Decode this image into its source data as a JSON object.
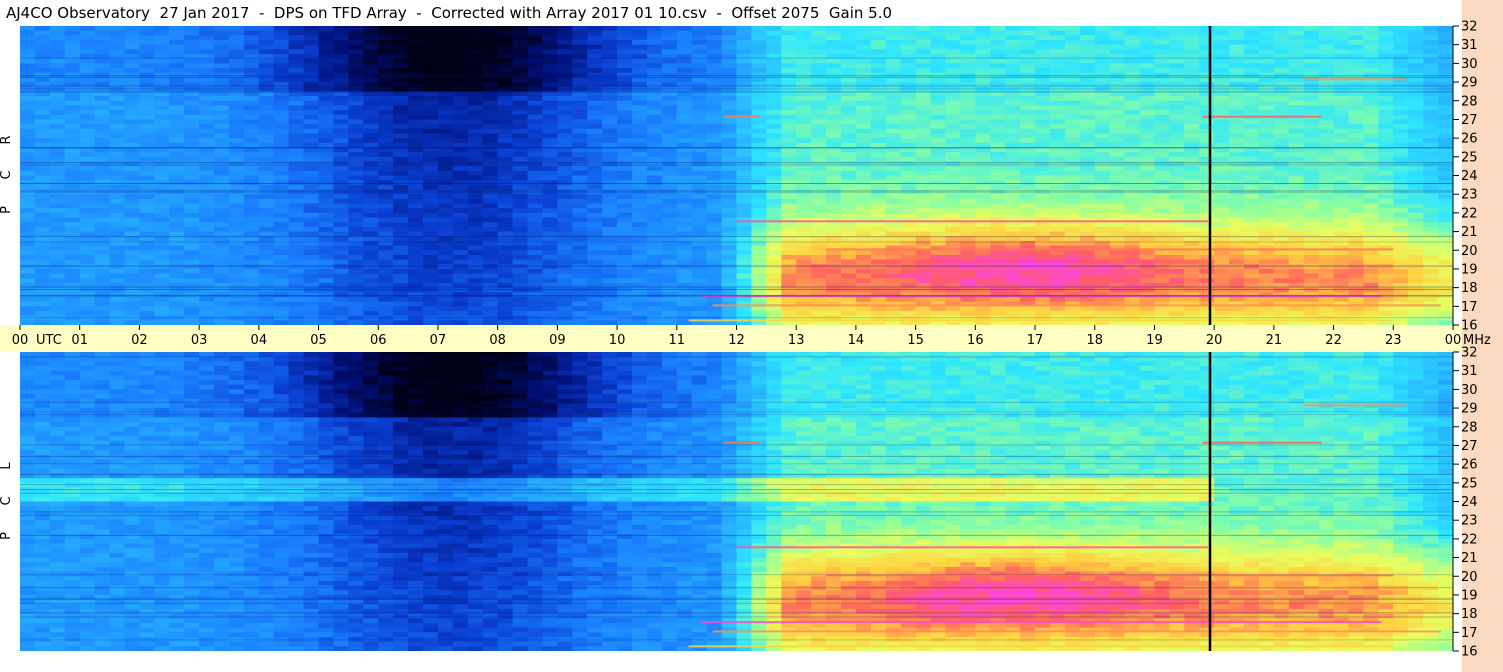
{
  "header": {
    "title": "AJ4CO Observatory  27 Jan 2017  -  DPS on TFD Array  -  Corrected with Array 2017 01 10.csv  -  Offset 2075  Gain 5.0"
  },
  "colors": {
    "frame_bg": "#ffffff",
    "time_band": "#ffffc4",
    "freq_strip": "#f9d9bf",
    "colormap": [
      "#000018",
      "#00107a",
      "#0a3fd2",
      "#1a80ff",
      "#28b4ff",
      "#2ee6ff",
      "#8cffa0",
      "#e8ff60",
      "#ffd040",
      "#ff6060",
      "#ff40ff",
      "#ffffff"
    ]
  },
  "chart_data": [
    {
      "type": "heatmap",
      "panel": "top",
      "polarization_label": [
        "R",
        "C",
        "P"
      ],
      "x_ticks": [
        "00",
        "01",
        "02",
        "03",
        "04",
        "05",
        "06",
        "07",
        "08",
        "09",
        "10",
        "11",
        "12",
        "13",
        "14",
        "15",
        "16",
        "17",
        "18",
        "19",
        "20",
        "21",
        "22",
        "23",
        "00"
      ],
      "x_unit": "UTC",
      "x_range_hours": [
        0,
        24
      ],
      "y_ticks": [
        16,
        17,
        18,
        19,
        20,
        21,
        22,
        23,
        24,
        25,
        26,
        27,
        28,
        29,
        30,
        31,
        32
      ],
      "y_unit": "MHz",
      "y_range_mhz": [
        16,
        32
      ],
      "marker_time_hours": 19.93
    },
    {
      "type": "heatmap",
      "panel": "bottom",
      "polarization_label": [
        "L",
        "C",
        "P"
      ],
      "x_ticks": [
        "00",
        "01",
        "02",
        "03",
        "04",
        "05",
        "06",
        "07",
        "08",
        "09",
        "10",
        "11",
        "12",
        "13",
        "14",
        "15",
        "16",
        "17",
        "18",
        "19",
        "20",
        "21",
        "22",
        "23",
        "00"
      ],
      "x_unit": "UTC",
      "x_range_hours": [
        0,
        24
      ],
      "y_ticks": [
        16,
        17,
        18,
        19,
        20,
        21,
        22,
        23,
        24,
        25,
        26,
        27,
        28,
        29,
        30,
        31,
        32
      ],
      "y_unit": "MHz",
      "y_range_mhz": [
        16,
        32
      ],
      "marker_time_hours": 19.93
    }
  ]
}
